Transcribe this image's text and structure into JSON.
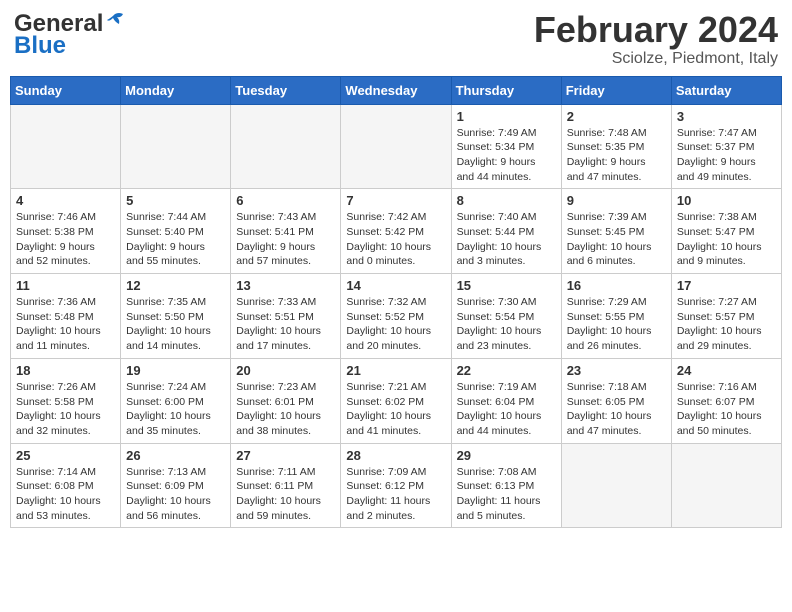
{
  "header": {
    "logo_line1": "General",
    "logo_line2": "Blue",
    "main_title": "February 2024",
    "sub_title": "Sciolze, Piedmont, Italy"
  },
  "columns": [
    "Sunday",
    "Monday",
    "Tuesday",
    "Wednesday",
    "Thursday",
    "Friday",
    "Saturday"
  ],
  "weeks": [
    [
      {
        "day": "",
        "info": ""
      },
      {
        "day": "",
        "info": ""
      },
      {
        "day": "",
        "info": ""
      },
      {
        "day": "",
        "info": ""
      },
      {
        "day": "1",
        "info": "Sunrise: 7:49 AM\nSunset: 5:34 PM\nDaylight: 9 hours\nand 44 minutes."
      },
      {
        "day": "2",
        "info": "Sunrise: 7:48 AM\nSunset: 5:35 PM\nDaylight: 9 hours\nand 47 minutes."
      },
      {
        "day": "3",
        "info": "Sunrise: 7:47 AM\nSunset: 5:37 PM\nDaylight: 9 hours\nand 49 minutes."
      }
    ],
    [
      {
        "day": "4",
        "info": "Sunrise: 7:46 AM\nSunset: 5:38 PM\nDaylight: 9 hours\nand 52 minutes."
      },
      {
        "day": "5",
        "info": "Sunrise: 7:44 AM\nSunset: 5:40 PM\nDaylight: 9 hours\nand 55 minutes."
      },
      {
        "day": "6",
        "info": "Sunrise: 7:43 AM\nSunset: 5:41 PM\nDaylight: 9 hours\nand 57 minutes."
      },
      {
        "day": "7",
        "info": "Sunrise: 7:42 AM\nSunset: 5:42 PM\nDaylight: 10 hours\nand 0 minutes."
      },
      {
        "day": "8",
        "info": "Sunrise: 7:40 AM\nSunset: 5:44 PM\nDaylight: 10 hours\nand 3 minutes."
      },
      {
        "day": "9",
        "info": "Sunrise: 7:39 AM\nSunset: 5:45 PM\nDaylight: 10 hours\nand 6 minutes."
      },
      {
        "day": "10",
        "info": "Sunrise: 7:38 AM\nSunset: 5:47 PM\nDaylight: 10 hours\nand 9 minutes."
      }
    ],
    [
      {
        "day": "11",
        "info": "Sunrise: 7:36 AM\nSunset: 5:48 PM\nDaylight: 10 hours\nand 11 minutes."
      },
      {
        "day": "12",
        "info": "Sunrise: 7:35 AM\nSunset: 5:50 PM\nDaylight: 10 hours\nand 14 minutes."
      },
      {
        "day": "13",
        "info": "Sunrise: 7:33 AM\nSunset: 5:51 PM\nDaylight: 10 hours\nand 17 minutes."
      },
      {
        "day": "14",
        "info": "Sunrise: 7:32 AM\nSunset: 5:52 PM\nDaylight: 10 hours\nand 20 minutes."
      },
      {
        "day": "15",
        "info": "Sunrise: 7:30 AM\nSunset: 5:54 PM\nDaylight: 10 hours\nand 23 minutes."
      },
      {
        "day": "16",
        "info": "Sunrise: 7:29 AM\nSunset: 5:55 PM\nDaylight: 10 hours\nand 26 minutes."
      },
      {
        "day": "17",
        "info": "Sunrise: 7:27 AM\nSunset: 5:57 PM\nDaylight: 10 hours\nand 29 minutes."
      }
    ],
    [
      {
        "day": "18",
        "info": "Sunrise: 7:26 AM\nSunset: 5:58 PM\nDaylight: 10 hours\nand 32 minutes."
      },
      {
        "day": "19",
        "info": "Sunrise: 7:24 AM\nSunset: 6:00 PM\nDaylight: 10 hours\nand 35 minutes."
      },
      {
        "day": "20",
        "info": "Sunrise: 7:23 AM\nSunset: 6:01 PM\nDaylight: 10 hours\nand 38 minutes."
      },
      {
        "day": "21",
        "info": "Sunrise: 7:21 AM\nSunset: 6:02 PM\nDaylight: 10 hours\nand 41 minutes."
      },
      {
        "day": "22",
        "info": "Sunrise: 7:19 AM\nSunset: 6:04 PM\nDaylight: 10 hours\nand 44 minutes."
      },
      {
        "day": "23",
        "info": "Sunrise: 7:18 AM\nSunset: 6:05 PM\nDaylight: 10 hours\nand 47 minutes."
      },
      {
        "day": "24",
        "info": "Sunrise: 7:16 AM\nSunset: 6:07 PM\nDaylight: 10 hours\nand 50 minutes."
      }
    ],
    [
      {
        "day": "25",
        "info": "Sunrise: 7:14 AM\nSunset: 6:08 PM\nDaylight: 10 hours\nand 53 minutes."
      },
      {
        "day": "26",
        "info": "Sunrise: 7:13 AM\nSunset: 6:09 PM\nDaylight: 10 hours\nand 56 minutes."
      },
      {
        "day": "27",
        "info": "Sunrise: 7:11 AM\nSunset: 6:11 PM\nDaylight: 10 hours\nand 59 minutes."
      },
      {
        "day": "28",
        "info": "Sunrise: 7:09 AM\nSunset: 6:12 PM\nDaylight: 11 hours\nand 2 minutes."
      },
      {
        "day": "29",
        "info": "Sunrise: 7:08 AM\nSunset: 6:13 PM\nDaylight: 11 hours\nand 5 minutes."
      },
      {
        "day": "",
        "info": ""
      },
      {
        "day": "",
        "info": ""
      }
    ]
  ]
}
